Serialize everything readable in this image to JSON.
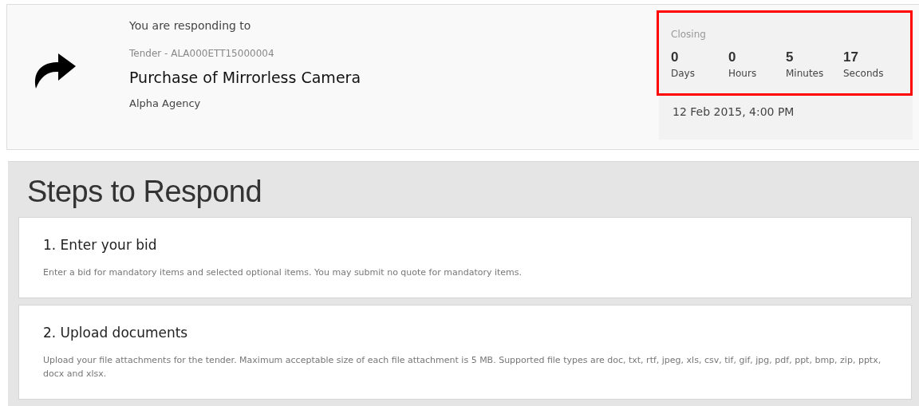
{
  "header": {
    "intro": "You are responding to",
    "reference": "Tender - ALA000ETT15000004",
    "title": "Purchase of Mirrorless Camera",
    "agency": "Alpha Agency"
  },
  "closing": {
    "label": "Closing",
    "countdown": [
      {
        "value": "0",
        "unit": "Days"
      },
      {
        "value": "0",
        "unit": "Hours"
      },
      {
        "value": "5",
        "unit": "Minutes"
      },
      {
        "value": "17",
        "unit": "Seconds"
      }
    ],
    "date": "12 Feb 2015, 4:00 PM"
  },
  "steps": {
    "title": "Steps to Respond",
    "items": [
      {
        "heading": "1. Enter your bid",
        "description": "Enter a bid for mandatory items and selected optional items. You may submit no quote for mandatory items."
      },
      {
        "heading": "2. Upload documents",
        "description": "Upload your file attachments for the tender. Maximum acceptable size of each file attachment is 5 MB. Supported file types are doc, txt, rtf, jpeg, xls, csv, tif, gif, jpg, pdf, ppt, bmp, zip, pptx, docx and xlsx."
      }
    ]
  }
}
